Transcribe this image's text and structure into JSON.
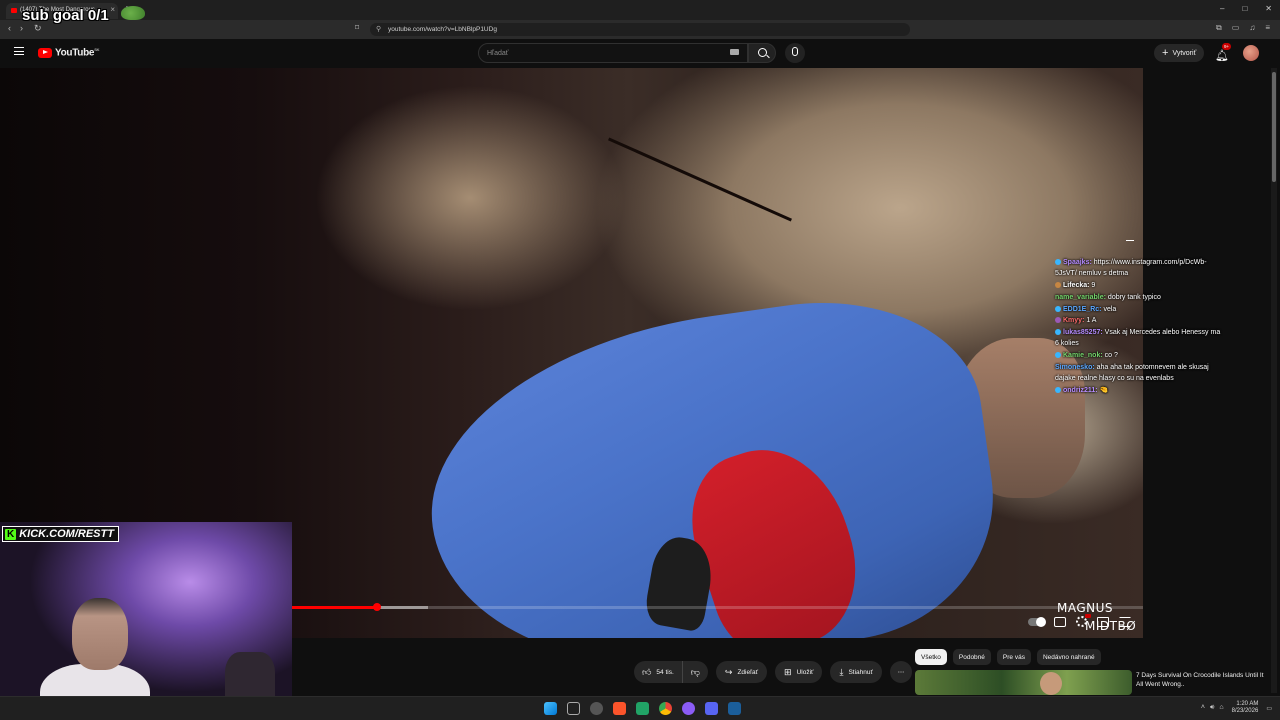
{
  "browser": {
    "tab_title": "(1407) The Most Dangerous...",
    "url": "youtube.com/watch?v=LbNBlpP1UDg",
    "window_controls": [
      "–",
      "□",
      "✕"
    ]
  },
  "overlay": {
    "sub_goal": "sub goal 0/1",
    "kick_logo": "K",
    "kick_url": "KICK.COM/RESTT",
    "watermark_line1": "MAGNUS",
    "watermark_line2": "MIDTBØ"
  },
  "youtube": {
    "logo_text": "YouTube",
    "country_code": "SK",
    "search_placeholder": "Hľadať",
    "create_label": "Vytvoriť",
    "notification_count": "9+"
  },
  "player": {
    "progress_fraction": 0.1,
    "buffer_fraction": 0.16,
    "accent_color": "#ff0000"
  },
  "chat": [
    {
      "user": "Spaajks:",
      "user_color": "#b58cff",
      "badge_color": "#38b6ff",
      "text": "https://www.instagram.com/p/DcWb-5JsVT/ nemluv s detma"
    },
    {
      "user": "Lifecka:",
      "user_color": "#ffffff",
      "badge_color": "#c68642",
      "text": "9"
    },
    {
      "user": "name_variable:",
      "user_color": "#73d36b",
      "badge_color": "",
      "text": "dobry tank typico"
    },
    {
      "user": "EDD1E_Rc:",
      "user_color": "#5aa7ff",
      "badge_color": "#38b6ff",
      "text": "vela"
    },
    {
      "user": "Kmyy:",
      "user_color": "#ff6b6b",
      "badge_color": "#9b59b6",
      "text": "1 A"
    },
    {
      "user": "lukas85257:",
      "user_color": "#b58cff",
      "badge_color": "#38b6ff",
      "text": "Vsak aj Mercedes alebo Henessy ma 6 kolies"
    },
    {
      "user": "Kamie_nok:",
      "user_color": "#73d36b",
      "badge_color": "#38b6ff",
      "text": "co ?"
    },
    {
      "user": "Simonesko:",
      "user_color": "#5aa7ff",
      "badge_color": "",
      "text": "aha aha tak potomnevem ale skusaj dajake realne hlasy co su na evenlabs"
    },
    {
      "user": "ondriz211:",
      "user_color": "#b58cff",
      "badge_color": "#38b6ff",
      "text": "🤏"
    }
  ],
  "actions": {
    "likes": "54 tis.",
    "share": "Zdieľať",
    "save": "Uložiť",
    "download": "Stiahnuť",
    "more": "⋯"
  },
  "chips": [
    "Všetko",
    "Podobné",
    "Pre vás",
    "Nedávno nahrané"
  ],
  "recommendation": {
    "title": "7 Days Survival On Crocodile Islands Until It All Went Wrong.."
  },
  "taskbar": {
    "time": "1:20 AM",
    "date": "8/23/2026"
  }
}
